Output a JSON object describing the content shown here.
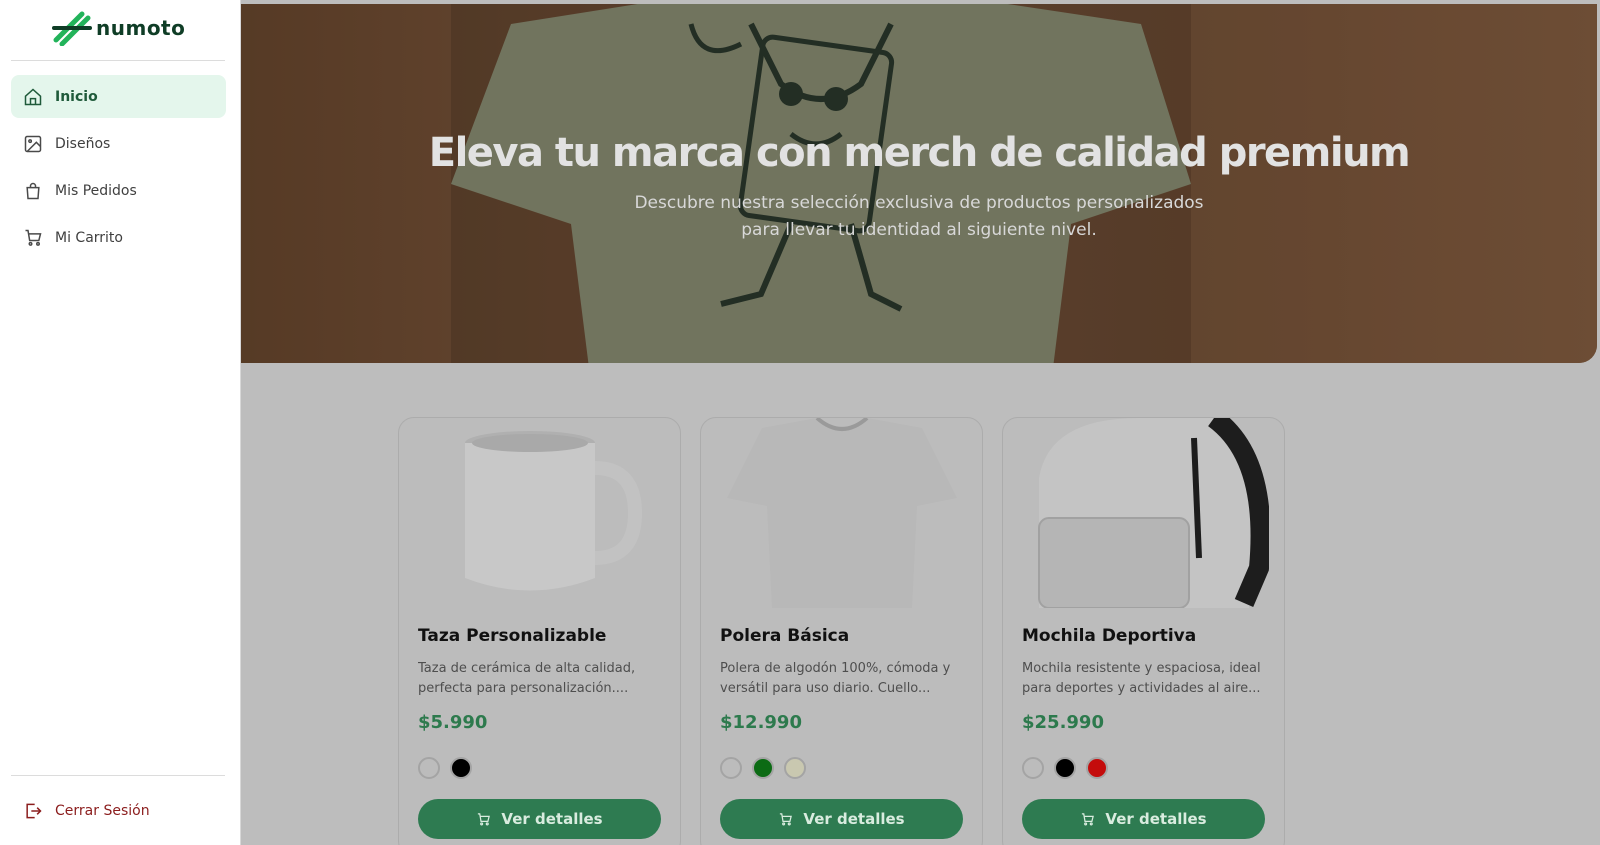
{
  "brand": {
    "name": "numoto"
  },
  "sidebar": {
    "items": [
      {
        "label": "Inicio",
        "icon": "home-icon",
        "active": true
      },
      {
        "label": "Diseños",
        "icon": "image-icon",
        "active": false
      },
      {
        "label": "Mis Pedidos",
        "icon": "shopping-bag-icon",
        "active": false
      },
      {
        "label": "Mi Carrito",
        "icon": "cart-icon",
        "active": false
      }
    ],
    "logout_label": "Cerrar Sesión"
  },
  "hero": {
    "title": "Eleva tu marca con merch de calidad premium",
    "subtitle_line1": "Descubre nuestra selección exclusiva de productos personalizados",
    "subtitle_line2": "para llevar tu identidad al siguiente nivel."
  },
  "products": [
    {
      "name": "Taza Personalizable",
      "description": "Taza de cerámica de alta calidad, perfecta para personalización....",
      "price": "$5.990",
      "image": "mug",
      "colors": [
        "#cfcfcf",
        "#000000"
      ],
      "button_label": "Ver detalles"
    },
    {
      "name": "Polera Básica",
      "description": "Polera de algodón 100%, cómoda y versátil para uso diario. Cuello...",
      "price": "$12.990",
      "image": "t-shirt",
      "colors": [
        "#cfcfcf",
        "#0c6b14",
        "#c9c8b0"
      ],
      "button_label": "Ver detalles"
    },
    {
      "name": "Mochila Deportiva",
      "description": "Mochila resistente y espaciosa, ideal para deportes y actividades al aire...",
      "price": "$25.990",
      "image": "backpack",
      "colors": [
        "#cfcfcf",
        "#000000",
        "#c40c0c"
      ],
      "button_label": "Ver detalles"
    }
  ],
  "colors": {
    "accent": "#2e7b51",
    "active_nav_bg": "#e4f6ec",
    "logout": "#8b1d1d"
  }
}
